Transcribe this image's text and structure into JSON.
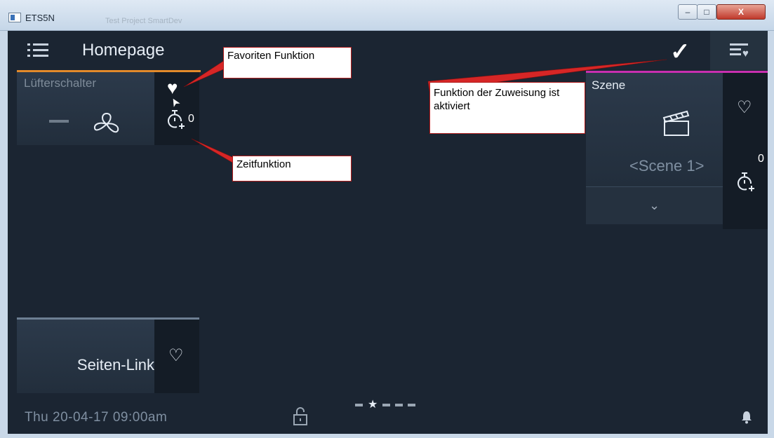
{
  "window": {
    "title": "ETS5N",
    "ghost_tab": "Test Project SmartDev",
    "close_glyph": "X",
    "minimize_glyph": "–",
    "maximize_glyph": "□"
  },
  "topbar": {
    "page_title": "Homepage",
    "menu_icon": "menu-list-icon",
    "confirm_icon": "checkmark-icon",
    "confirm_glyph": "✓",
    "favorites_icon": "favorites-list-icon"
  },
  "tiles": {
    "fan": {
      "label": "Lüfterschalter",
      "timer_count": "0",
      "favorite": true
    },
    "link": {
      "label": "Seiten-Link",
      "favorite": false
    },
    "scene": {
      "label": "Szene",
      "value": "<Scene 1>",
      "timer_count": "0",
      "favorite": false
    }
  },
  "footer": {
    "datetime": "Thu 20-04-17  09:00am",
    "page_count": 5,
    "active_page": 2
  },
  "glyphs": {
    "heart_filled": "♥",
    "heart_outline": "♡",
    "chevron": "⌄",
    "star": "★",
    "cursor": "➤"
  },
  "callouts": {
    "favorite": "Favoriten Funktion",
    "timer": "Zeitfunktion",
    "assignment": "Funktion der Zuweisung ist aktiviert"
  },
  "colors": {
    "screen_bg": "#1b2532",
    "accent_orange": "#e38a2a",
    "accent_magenta": "#c92fb0",
    "callout_line": "#d62626"
  }
}
